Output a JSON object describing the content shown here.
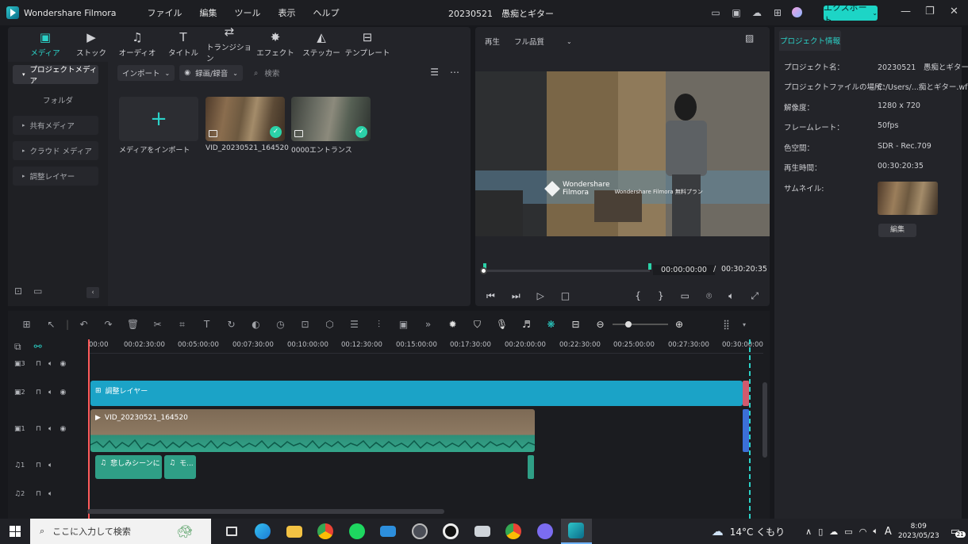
{
  "app": {
    "title": "Wondershare Filmora",
    "project_title": "20230521　愚痴とギター",
    "export_label": "エクスポート"
  },
  "menu": [
    "ファイル",
    "編集",
    "ツール",
    "表示",
    "ヘルプ"
  ],
  "tabs": [
    {
      "label": "メディア",
      "icon": "media-icon"
    },
    {
      "label": "ストック",
      "icon": "stock-icon"
    },
    {
      "label": "オーディオ",
      "icon": "music-icon"
    },
    {
      "label": "タイトル",
      "icon": "title-icon"
    },
    {
      "label": "トランジション",
      "icon": "transition-icon"
    },
    {
      "label": "エフェクト",
      "icon": "effect-icon"
    },
    {
      "label": "ステッカー",
      "icon": "sticker-icon"
    },
    {
      "label": "テンプレート",
      "icon": "template-icon"
    }
  ],
  "sidebar": {
    "items": [
      {
        "label": "プロジェクトメディア"
      },
      {
        "label": "フォルダ"
      },
      {
        "label": "共有メディア"
      },
      {
        "label": "クラウド メディア"
      },
      {
        "label": "調整レイヤー"
      }
    ]
  },
  "media_toolbar": {
    "import": "インポート",
    "record": "録画/録音",
    "search_placeholder": "検索"
  },
  "media_items": [
    {
      "label": "メディアをインポート"
    },
    {
      "label": "VID_20230521_164520"
    },
    {
      "label": "0000エントランス"
    }
  ],
  "preview": {
    "play_label": "再生",
    "quality": "フル品質",
    "current_time": "00:00:00:00",
    "separator": "/",
    "total_time": "00:30:20:35",
    "watermark_title": "Wondershare",
    "watermark_sub": "Filmora",
    "watermark_plan": "Wondershare Filmora 無料プラン",
    "progress": 0.0
  },
  "project_info": {
    "tab": "プロジェクト情報",
    "rows": [
      {
        "key": "プロジェクト名：",
        "value": "20230521　愚痴とギター"
      },
      {
        "key": "プロジェクトファイルの場所：",
        "value": "C:/Users/...痴とギター.wfp"
      },
      {
        "key": "解像度：",
        "value": "1280 x 720"
      },
      {
        "key": "フレームレート：",
        "value": "50fps"
      },
      {
        "key": "色空間：",
        "value": "SDR - Rec.709"
      },
      {
        "key": "再生時間：",
        "value": "00:30:20:35"
      },
      {
        "key": "サムネイル:",
        "value": ""
      }
    ],
    "edit_label": "編集"
  },
  "timeline": {
    "ticks": [
      "00:00",
      "00:02:30:00",
      "00:05:00:00",
      "00:07:30:00",
      "00:10:00:00",
      "00:12:30:00",
      "00:15:00:00",
      "00:17:30:00",
      "00:20:00:00",
      "00:22:30:00",
      "00:25:00:00",
      "00:27:30:00",
      "00:30:00:00"
    ],
    "tracks": [
      {
        "name": "3"
      },
      {
        "name": "2"
      },
      {
        "name": "1"
      },
      {
        "name": "1"
      },
      {
        "name": "2"
      }
    ],
    "clips": {
      "adjust": "調整レイヤー",
      "video": "VID_20230521_164520",
      "audio1": "悲しみシーンに",
      "audio2": "モ..."
    }
  },
  "taskbar": {
    "search_placeholder": "ここに入力して検索",
    "weather": "14°C くもり",
    "time": "8:09",
    "date": "2023/05/23",
    "notifications": "21",
    "ime": "A"
  }
}
